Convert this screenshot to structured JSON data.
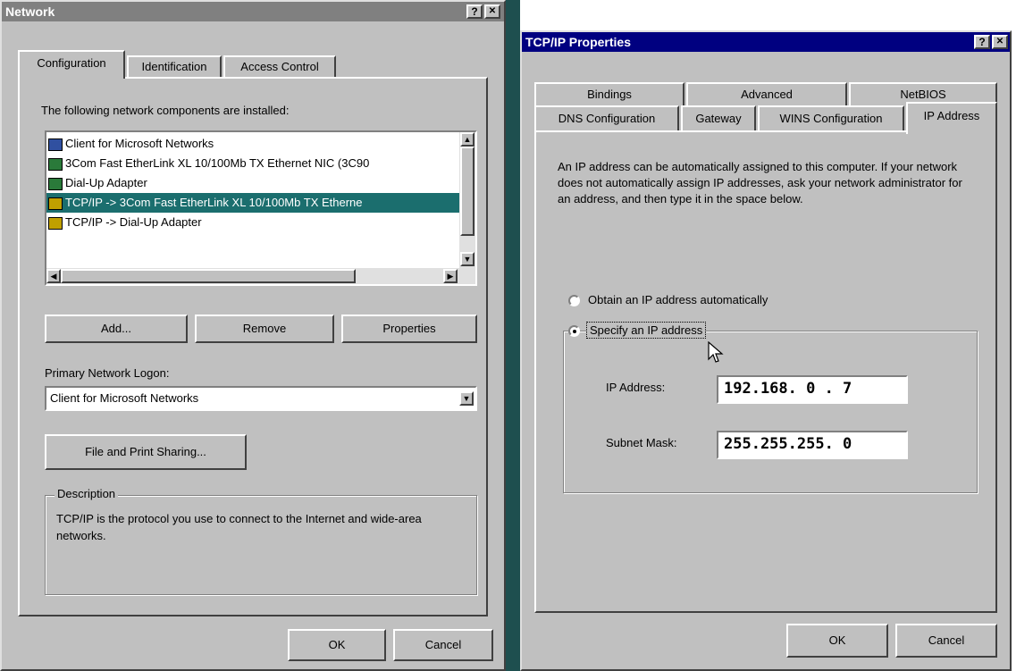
{
  "network": {
    "title": "Network",
    "help": "?",
    "close": "✕",
    "tabs": [
      "Configuration",
      "Identification",
      "Access Control"
    ],
    "components_label": "The following network components are installed:",
    "components": [
      "Client for Microsoft Networks",
      "3Com Fast EtherLink XL 10/100Mb TX Ethernet NIC (3C90",
      "Dial-Up Adapter",
      "TCP/IP -> 3Com Fast EtherLink XL 10/100Mb TX Etherne",
      "TCP/IP -> Dial-Up Adapter"
    ],
    "selected_component_index": 3,
    "add_label": "Add...",
    "remove_label": "Remove",
    "properties_label": "Properties",
    "primary_logon_label": "Primary Network Logon:",
    "primary_logon_value": "Client for Microsoft Networks",
    "file_print_label": "File and Print Sharing...",
    "description_label": "Description",
    "description_text": "TCP/IP is the protocol you use to connect to the Internet and wide-area networks.",
    "ok_label": "OK",
    "cancel_label": "Cancel",
    "title_color": "#808080"
  },
  "tcpip": {
    "title": "TCP/IP Properties",
    "help": "?",
    "close": "✕",
    "tabs_back": [
      "Bindings",
      "Advanced",
      "NetBIOS"
    ],
    "tabs_front": [
      "DNS Configuration",
      "Gateway",
      "WINS Configuration",
      "IP Address"
    ],
    "intro_text": "An IP address can be automatically assigned to this computer. If your network does not automatically assign IP addresses, ask your network administrator for an address, and then type it in the space below.",
    "obtain_label": "Obtain an IP address automatically",
    "specify_label": "Specify an IP address",
    "selected_option": "specify",
    "ip_label": "IP Address:",
    "ip_value": "192.168. 0 . 7",
    "subnet_label": "Subnet Mask:",
    "subnet_value": "255.255.255. 0",
    "ok_label": "OK",
    "cancel_label": "Cancel",
    "title_color": "#000080"
  },
  "colors": {
    "face": "#c0c0c0",
    "selection": "#1b6e6e",
    "divider": "#1e4f4f"
  }
}
